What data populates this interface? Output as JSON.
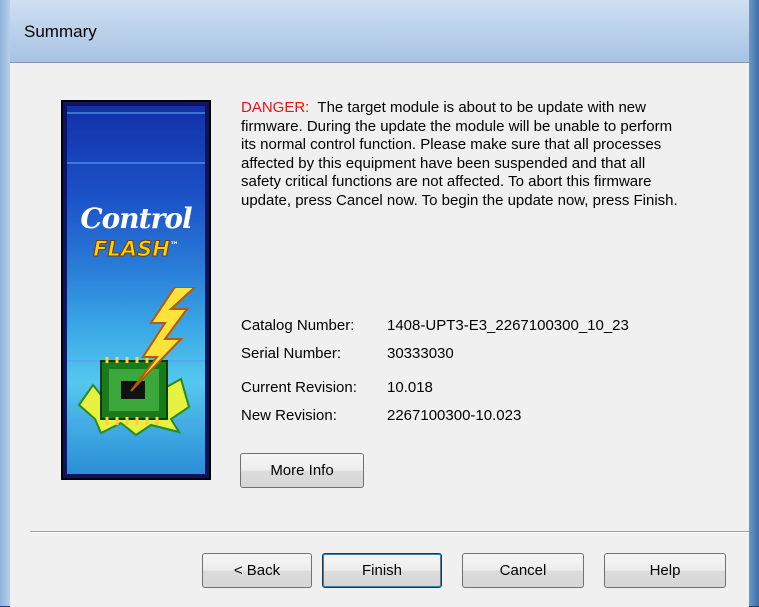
{
  "window": {
    "title": "Summary"
  },
  "banner": {
    "word1": "Control",
    "word2": "FLASH",
    "trademark": "™"
  },
  "warning": {
    "label": "DANGER:",
    "message": "The target module is about to be update with new firmware. During the update the module will be unable to perform its normal control function. Please make sure that all processes affected by this equipment have been suspended and that all safety critical functions are not affected. To abort this firmware update, press Cancel now. To begin the update now, press Finish."
  },
  "details": {
    "catalog_label": "Catalog Number:",
    "catalog_value": "1408-UPT3-E3_2267100300_10_23",
    "serial_label": "Serial Number:",
    "serial_value": "30333030",
    "current_rev_label": "Current Revision:",
    "current_rev_value": "10.018",
    "new_rev_label": "New Revision:",
    "new_rev_value": "2267100300-10.023"
  },
  "buttons": {
    "more_info": "More Info",
    "back": "< Back",
    "finish": "Finish",
    "cancel": "Cancel",
    "help": "Help"
  },
  "colors": {
    "danger": "#ee1111",
    "title_bar": "#b9d0ea",
    "dialog_bg": "#f0f0f0"
  }
}
